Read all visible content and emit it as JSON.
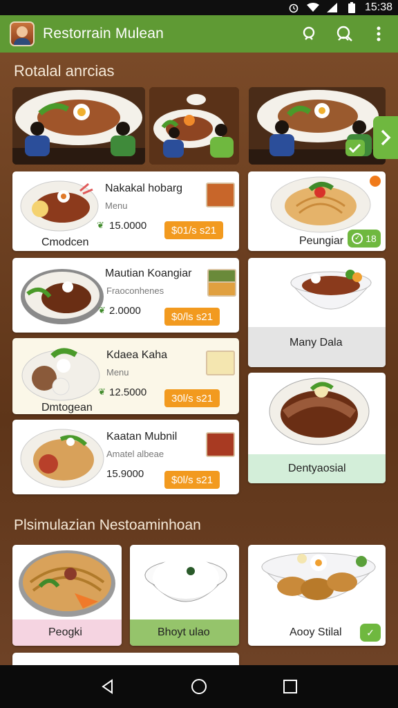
{
  "status_bar": {
    "time": "15:38",
    "icons": [
      "alarm-icon",
      "wifi-icon",
      "signal-icon",
      "battery-icon"
    ]
  },
  "app_bar": {
    "title": "Restorrain Mulean",
    "actions": [
      "search-icon",
      "profile-search-icon",
      "more-vert-icon"
    ]
  },
  "section_top": {
    "title": "Rotalal anrcias"
  },
  "menu_left": [
    {
      "name": "Nakakal hobarg",
      "sub": "Menu",
      "price": "15.0000",
      "order": "$01/s s21",
      "caption": "Cmodcen"
    },
    {
      "name": "Mautian Koangiar",
      "sub": "Fraoconhenes",
      "price": "2.0000",
      "order": "$0/ls s21",
      "caption": ""
    },
    {
      "name": "Kdaea Kaha",
      "sub": "Menu",
      "price": "12.5000",
      "order": "30l/s s21",
      "caption": "Dmtogean"
    },
    {
      "name": "Kaatan Mubnil",
      "sub": "Amatel albeae",
      "price": "15.9000",
      "order": "$0l/s s21",
      "caption": ""
    }
  ],
  "menu_right": [
    {
      "caption": "Peungiar",
      "badge": "18"
    },
    {
      "caption": "Many Dala"
    },
    {
      "caption": "Dentyaosial"
    }
  ],
  "section_bottom": {
    "title": "Plsimulazian Nestoaminhoan"
  },
  "bottom_cards": [
    {
      "caption": "Peogki"
    },
    {
      "caption": "Bhoyt ulao"
    },
    {
      "caption": "Aooy Stilal"
    }
  ],
  "colors": {
    "app_bar": "#5f9a34",
    "accent_orange": "#f29a1f",
    "accent_green": "#6fb83f",
    "background": "#6b3f22"
  },
  "nav": [
    "back-icon",
    "home-icon",
    "recents-icon"
  ]
}
